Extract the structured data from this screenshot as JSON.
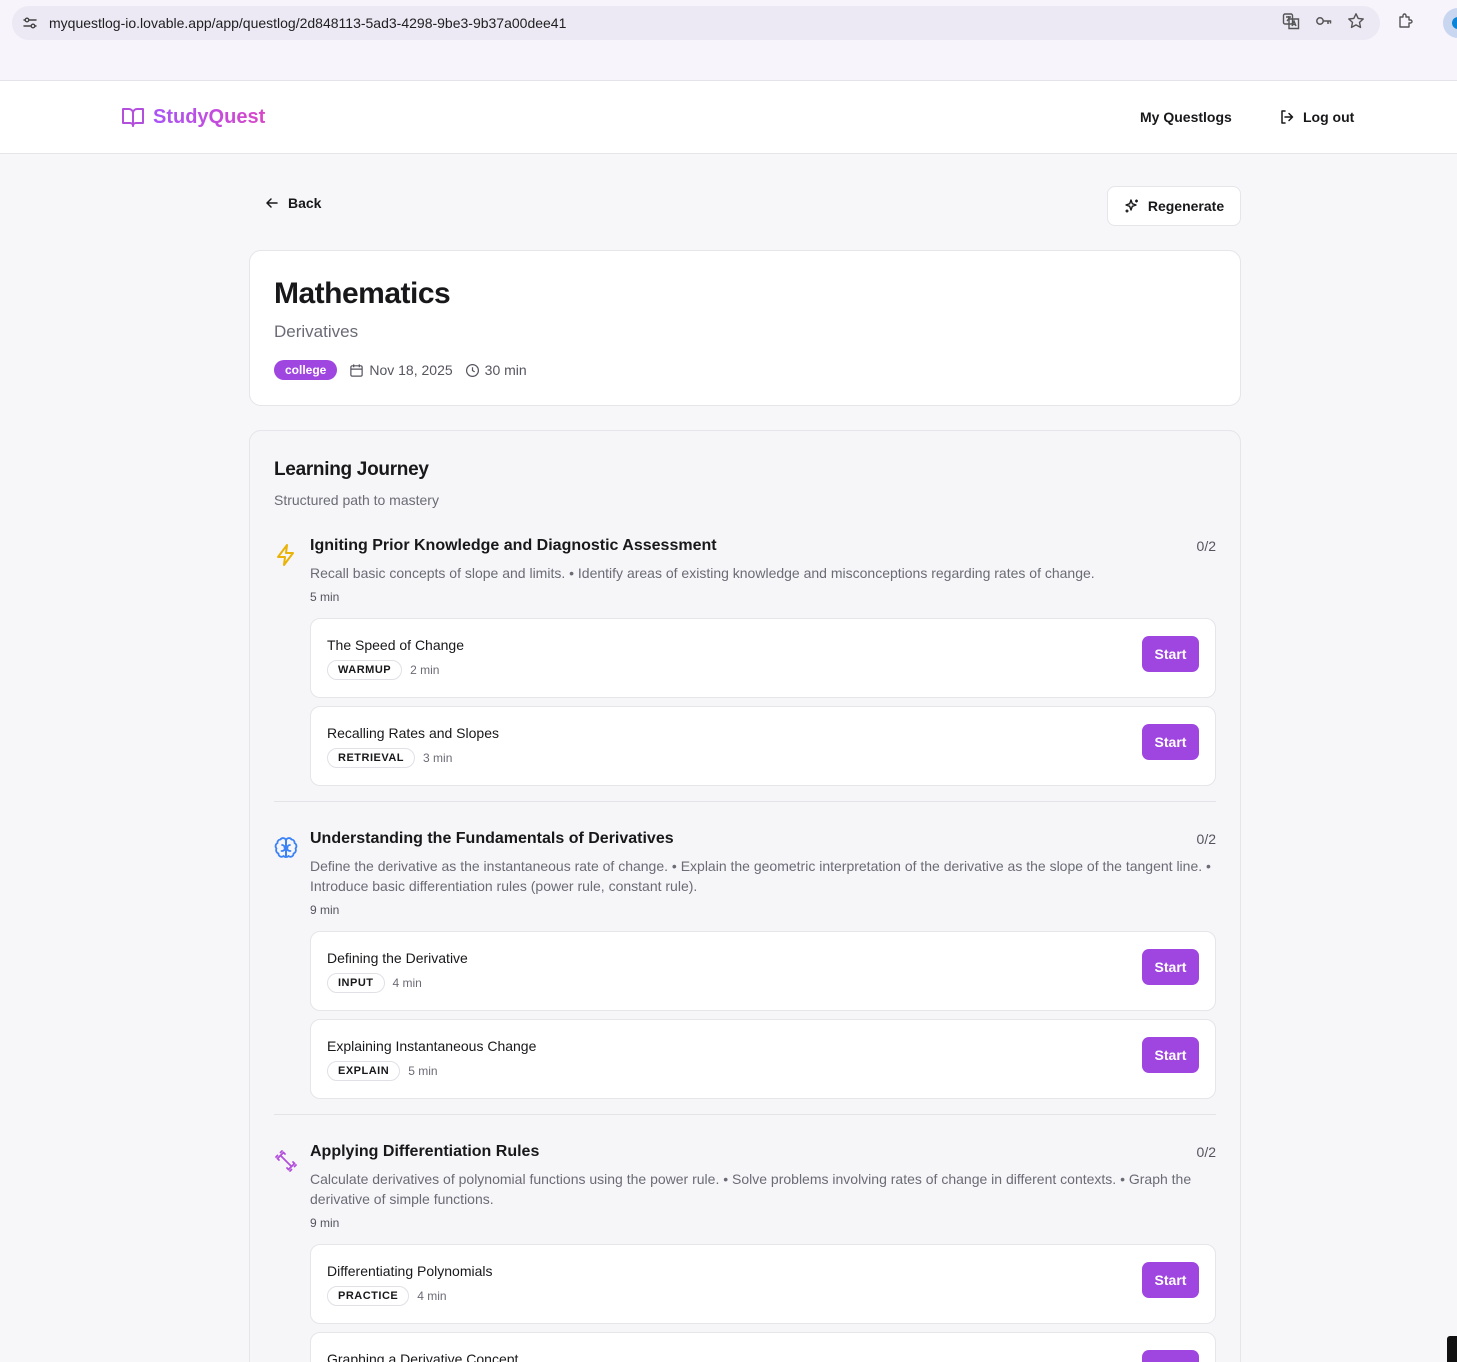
{
  "browser": {
    "url": "myquestlog-io.lovable.app/app/questlog/2d848113-5ad3-4298-9be3-9b37a00dee41",
    "icons": [
      "tune-icon",
      "translate-icon",
      "key-icon",
      "star-icon",
      "extensions-icon",
      "profile-avatar"
    ]
  },
  "app": {
    "brand": "StudyQuest",
    "nav": {
      "questlogs": "My Questlogs",
      "logout": "Log out"
    }
  },
  "toolbar": {
    "back": "Back",
    "regenerate": "Regenerate"
  },
  "topic": {
    "title": "Mathematics",
    "subtitle": "Derivatives",
    "level": "college",
    "date": "Nov 18, 2025",
    "duration": "30 min"
  },
  "journey": {
    "title": "Learning Journey",
    "subtitle": "Structured path to mastery",
    "phases": [
      {
        "icon": "lightning-icon",
        "title": "Igniting Prior Knowledge and Diagnostic Assessment",
        "count": "0/2",
        "description": "Recall basic concepts of slope and limits. • Identify areas of existing knowledge and misconceptions regarding rates of change.",
        "duration": "5 min",
        "activities": [
          {
            "title": "The Speed of Change",
            "type": "WARMUP",
            "duration": "2 min",
            "action": "Start"
          },
          {
            "title": "Recalling Rates and Slopes",
            "type": "RETRIEVAL",
            "duration": "3 min",
            "action": "Start"
          }
        ]
      },
      {
        "icon": "brain-icon",
        "title": "Understanding the Fundamentals of Derivatives",
        "count": "0/2",
        "description": "Define the derivative as the instantaneous rate of change. • Explain the geometric interpretation of the derivative as the slope of the tangent line. • Introduce basic differentiation rules (power rule, constant rule).",
        "duration": "9 min",
        "activities": [
          {
            "title": "Defining the Derivative",
            "type": "INPUT",
            "duration": "4 min",
            "action": "Start"
          },
          {
            "title": "Explaining Instantaneous Change",
            "type": "EXPLAIN",
            "duration": "5 min",
            "action": "Start"
          }
        ]
      },
      {
        "icon": "dumbbell-icon",
        "title": "Applying Differentiation Rules",
        "count": "0/2",
        "description": "Calculate derivatives of polynomial functions using the power rule. • Solve problems involving rates of change in different contexts. • Graph the derivative of simple functions.",
        "duration": "9 min",
        "activities": [
          {
            "title": "Differentiating Polynomials",
            "type": "PRACTICE",
            "duration": "4 min",
            "action": "Start"
          },
          {
            "title": "Graphing a Derivative Concept",
            "type": "",
            "duration": "",
            "action": "Start"
          }
        ]
      }
    ]
  },
  "colors": {
    "accent": "#9f45e0",
    "brand_gradient_start": "#a855f7",
    "brand_gradient_end": "#d946c8",
    "lightning": "#eab308",
    "brain": "#3b82f6"
  }
}
